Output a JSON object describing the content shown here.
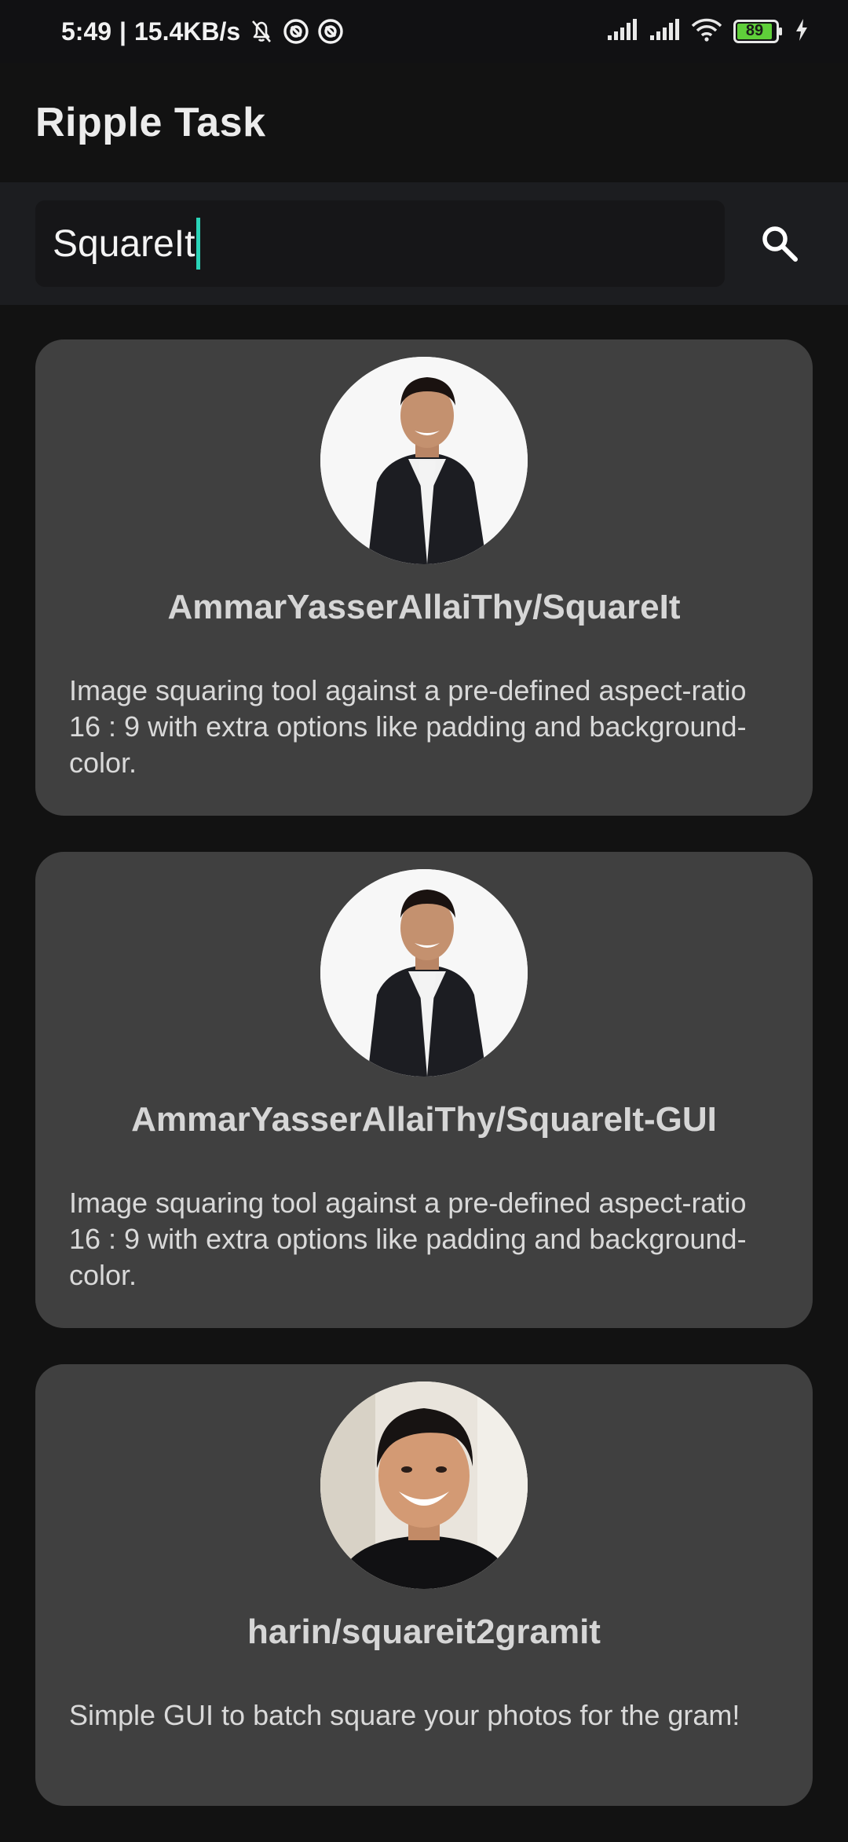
{
  "status_bar": {
    "time": "5:49",
    "network_speed": "15.4KB/s",
    "icons": [
      "bell-off-icon",
      "at-sign-icon",
      "at-sign-icon",
      "signal-icon",
      "signal-icon",
      "wifi-icon",
      "battery-icon",
      "charging-icon"
    ],
    "battery_level": "89"
  },
  "app_bar": {
    "title": "Ripple Task"
  },
  "search": {
    "value": "SquareIt",
    "button_icon": "search-icon"
  },
  "colors": {
    "accent": "#2ad4b8",
    "card_bg": "#404040",
    "battery": "#5fcf3a"
  },
  "results": [
    {
      "title": "AmmarYasserAllaiThy/SquareIt",
      "description": "Image squaring tool against a pre-defined aspect-ratio 16 : 9 with extra options like padding and background-color.",
      "avatar": "avatar-man-suit"
    },
    {
      "title": "AmmarYasserAllaiThy/SquareIt-GUI",
      "description": "Image squaring tool against a pre-defined aspect-ratio 16 : 9 with extra options like padding and background-color.",
      "avatar": "avatar-man-suit"
    },
    {
      "title": "harin/squareit2gramit",
      "description": "Simple GUI to batch square your photos for the gram!",
      "avatar": "avatar-smiling-man"
    }
  ]
}
